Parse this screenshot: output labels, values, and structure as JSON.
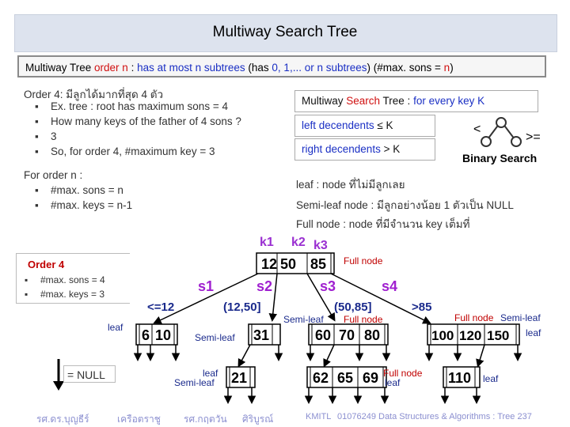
{
  "title": "Multiway Search Tree",
  "definition": {
    "part1": "Multiway Tree ",
    "part2": "order n",
    "part3": " : ",
    "part4": "has at most n subtrees",
    "part5": " (has ",
    "part6": "0, 1,... or n subtrees",
    "part7": ") (#max. sons = ",
    "part8": "n",
    "part9": ")"
  },
  "order4_text": {
    "heading": "Order 4: มีลูกได้มากที่สุด 4 ตัว",
    "bullets": [
      "Ex. tree : root has maximum sons = 4",
      "How many keys of the father of 4 sons ?",
      "3",
      "So, for order 4, #maximum key = 3"
    ]
  },
  "order_n": {
    "heading": "For order n :",
    "bullets": [
      "#max. sons = n",
      "#max. keys = n-1"
    ]
  },
  "search_box": {
    "part1": "Multiway ",
    "part2": "Search",
    "part3": " Tree : ",
    "part4": "for every key  K"
  },
  "left_box": {
    "part1": "left decendents",
    "part2": " ≤ K"
  },
  "right_box": {
    "part1": "right decendents",
    "part2": " > K"
  },
  "binary": {
    "lt": "<",
    "ge": ">=",
    "label": "Binary Search"
  },
  "node_defs": [
    "leaf : node ที่ไม่มีลูกเลย",
    "Semi-leaf node : มีลูกอย่างน้อย 1 ตัวเป็น NULL",
    "Full node : node ที่มีจำนวน key เต็มที่"
  ],
  "order4_box": {
    "title": "Order 4",
    "items": [
      "#max. sons = 4",
      "#max. keys = 3"
    ]
  },
  "tree": {
    "key_labels": [
      "k1",
      "k2",
      "k3"
    ],
    "root": [
      "12",
      "50",
      "85"
    ],
    "subtree_labels": [
      "s1",
      "s2",
      "s3",
      "s4"
    ],
    "ranges": [
      "<=12",
      "(12,50]",
      "(50,85]",
      ">85"
    ],
    "nodes": {
      "a": [
        "6",
        "10"
      ],
      "b": [
        "31"
      ],
      "c": [
        "21"
      ],
      "d": [
        "60",
        "70",
        "80"
      ],
      "e": [
        "62",
        "65",
        "69"
      ],
      "f": [
        "100",
        "120",
        "150"
      ],
      "g": [
        "110"
      ]
    },
    "labels": {
      "full_root": "Full node",
      "leaf_a": "leaf",
      "semi_b": "Semi-leaf",
      "leaf_c": "leaf",
      "semi_c": "Semi-leaf",
      "semi_mid": "Semi-leaf",
      "full_d": "Full node",
      "full_e": "Full node",
      "leaf_e": "leaf",
      "full_f": "Full node",
      "semi_f": "Semi-leaf",
      "leaf_f": "leaf",
      "leaf_g": "leaf"
    }
  },
  "null_legend": "= NULL",
  "footer": {
    "author1": "รศ.ดร.บุญธีร์",
    "author1b": "เครือตราชู",
    "author2": "รศ.กฤตวัน",
    "author2b": "ศิริบูรณ์",
    "org": "KMITL",
    "course": "01076249 Data Structures & Algorithms : Tree 237"
  }
}
